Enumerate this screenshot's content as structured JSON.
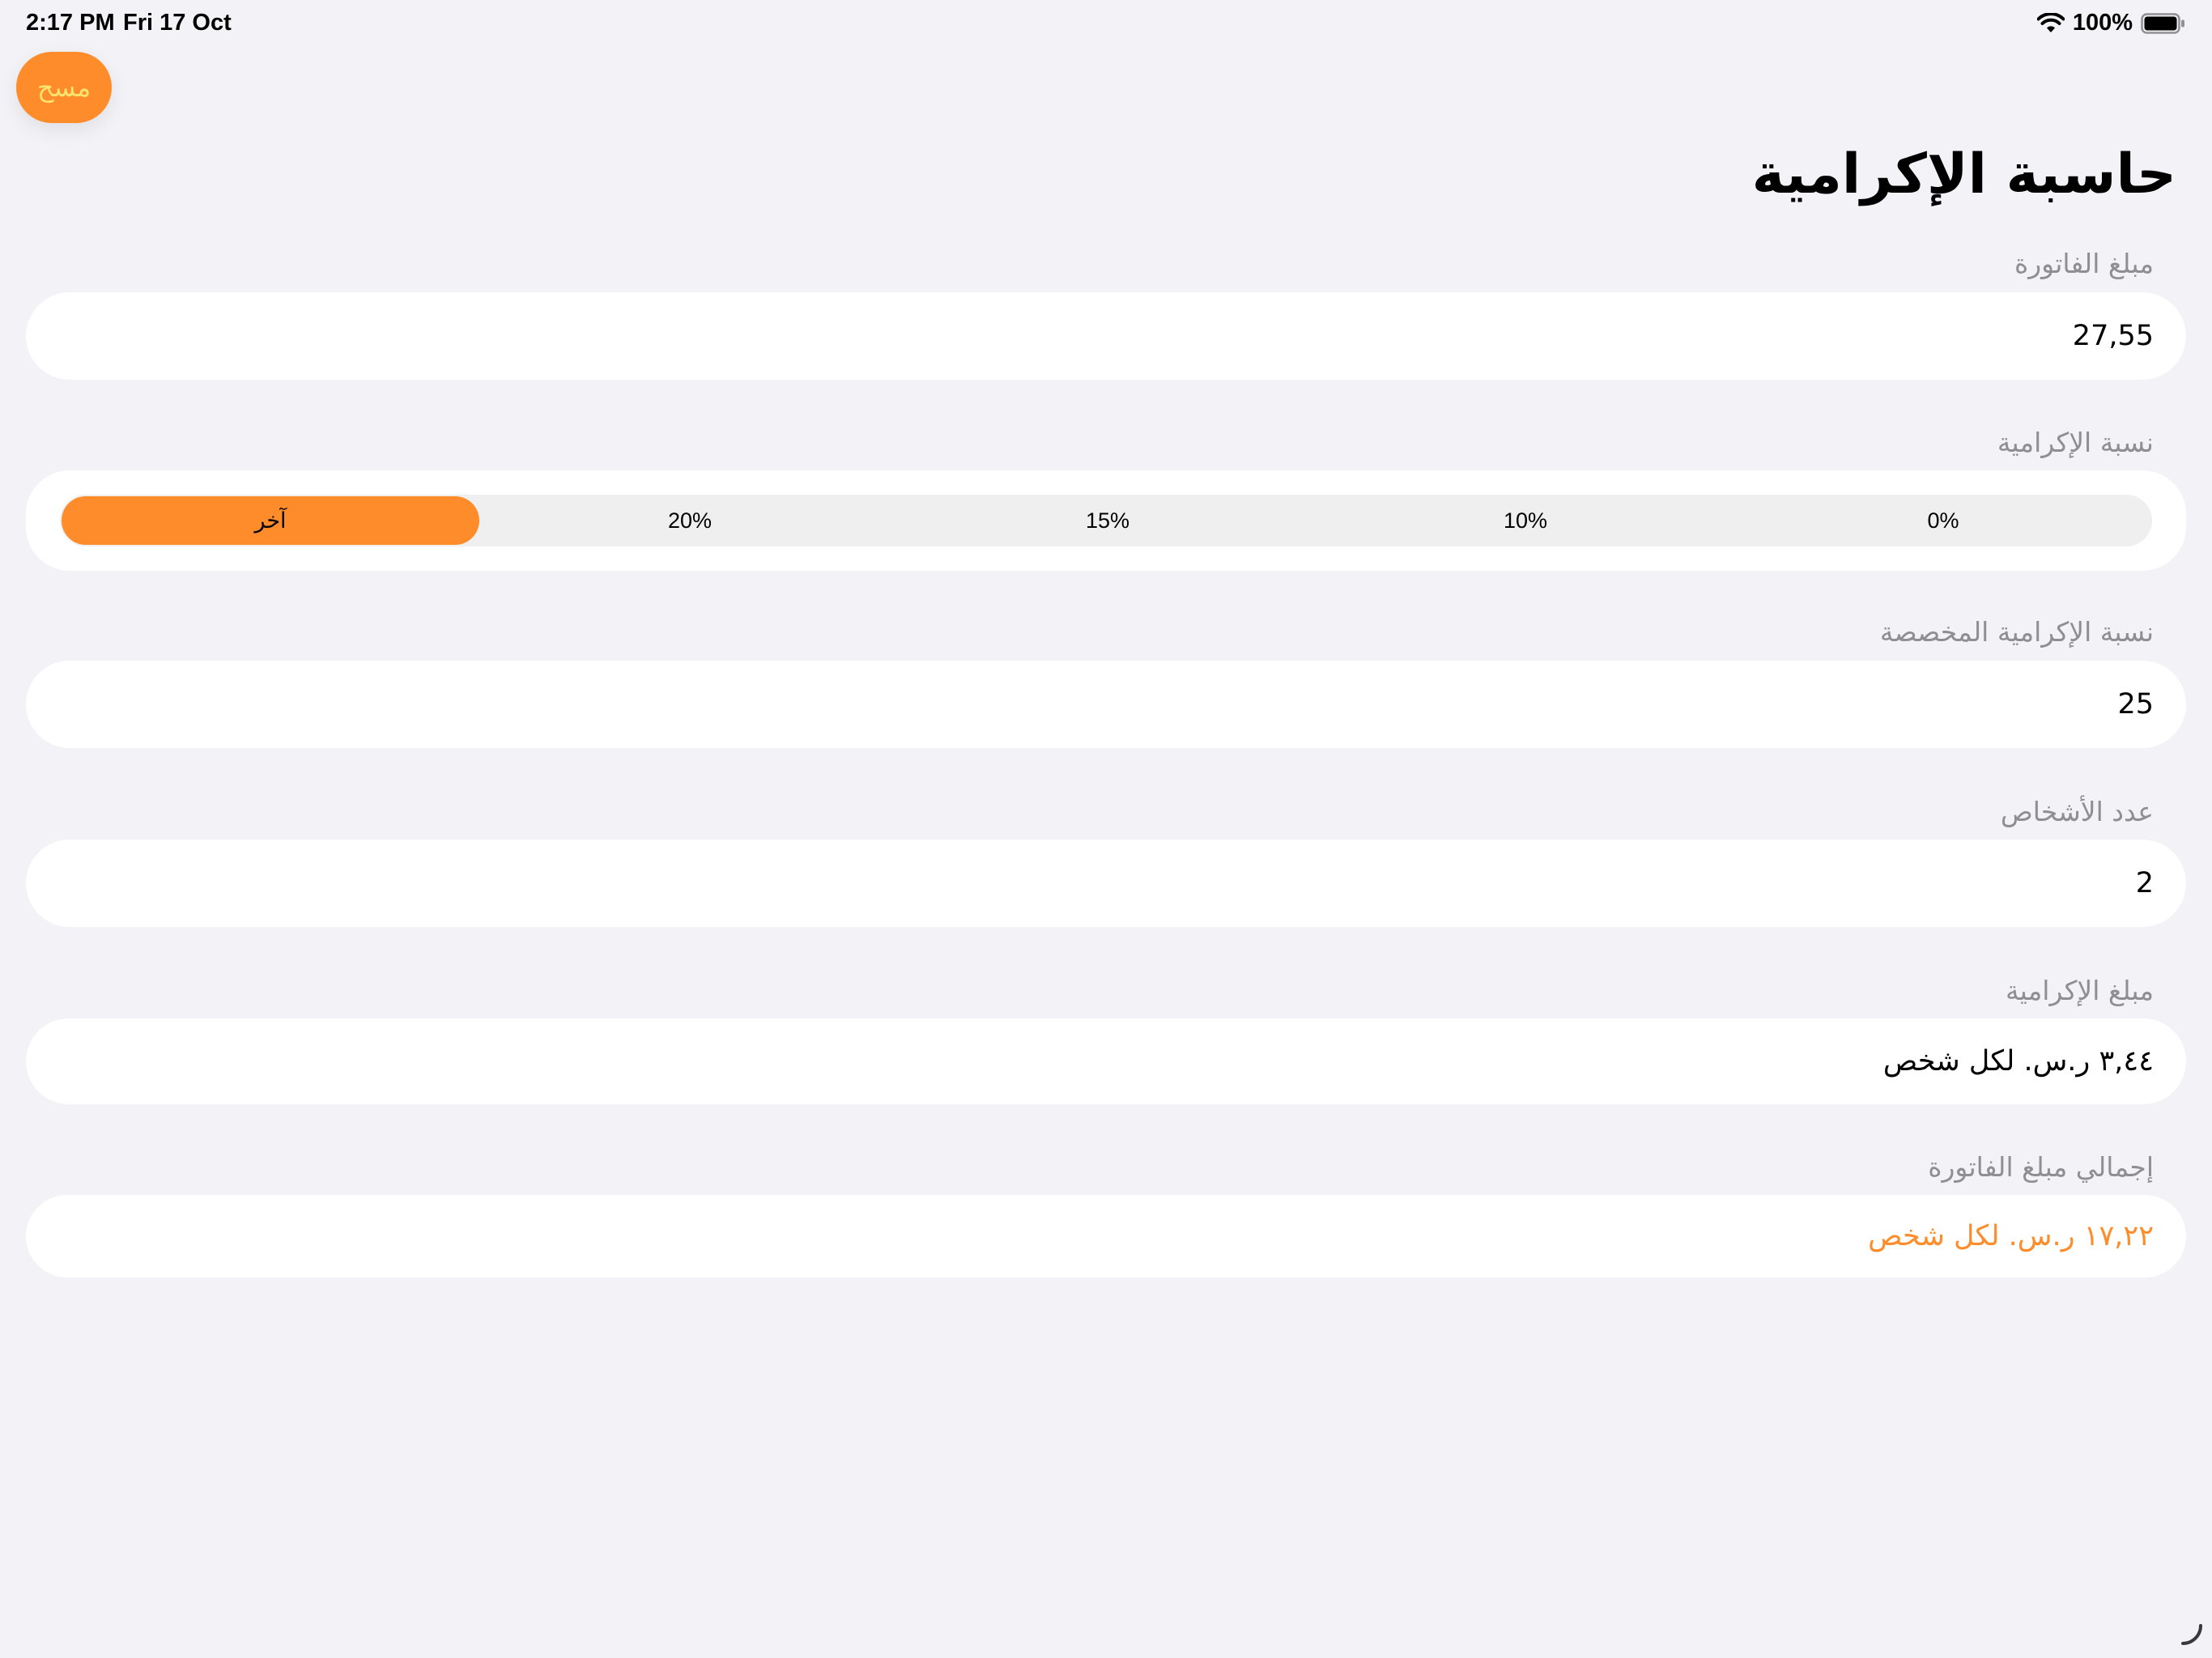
{
  "status_bar": {
    "time": "2:17 PM",
    "date": "Fri 17 Oct",
    "battery": "100%"
  },
  "toolbar": {
    "clear_label": "مسح"
  },
  "page": {
    "title": "حاسبة الإكرامية"
  },
  "bill": {
    "label": "مبلغ الفاتورة",
    "value": "27,55"
  },
  "tip_percent": {
    "label": "نسبة الإكرامية",
    "options": [
      "0%",
      "10%",
      "15%",
      "20%",
      "آخر"
    ],
    "selected": "آخر"
  },
  "custom_tip": {
    "label": "نسبة الإكرامية المخصصة",
    "value": "25"
  },
  "people": {
    "label": "عدد الأشخاص",
    "value": "2"
  },
  "tip_amount": {
    "label": "مبلغ الإكرامية",
    "value": "٣,٤٤ ر.س. لكل شخص"
  },
  "total": {
    "label": "إجمالي مبلغ الفاتورة",
    "value": "١٧,٢٢ ر.س. لكل شخص"
  },
  "colors": {
    "accent": "#FF8C2A",
    "clear_text": "#FFE36E",
    "background": "#F2F2F7",
    "label": "#8E8E93"
  }
}
